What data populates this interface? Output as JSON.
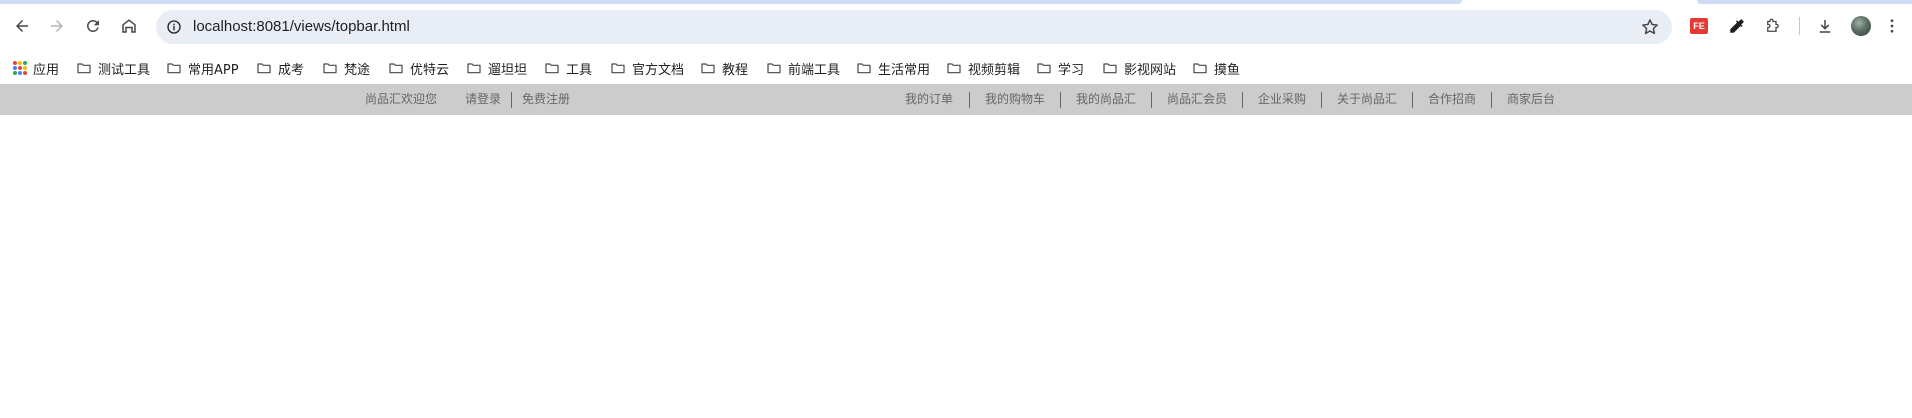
{
  "browser": {
    "url": "localhost:8081/views/topbar.html",
    "extension_badge": "FE",
    "icons": {
      "back": "arrow-left-icon",
      "forward": "arrow-right-icon",
      "reload": "reload-icon",
      "home": "home-icon",
      "site_info": "info-icon",
      "bookmark_star": "star-icon",
      "eyedropper": "eyedropper-icon",
      "extensions": "puzzle-icon",
      "downloads": "download-icon",
      "menu": "kebab-menu-icon"
    }
  },
  "bookmarks": {
    "apps_label": "应用",
    "folders": [
      "测试工具",
      "常用APP",
      "成考",
      "梵途",
      "优特云",
      "遛坦坦",
      "工具",
      "官方文档",
      "教程",
      "前端工具",
      "生活常用",
      "视频剪辑",
      "学习",
      "影视网站",
      "摸鱼"
    ]
  },
  "topbar": {
    "welcome": "尚品汇欢迎您",
    "login": "请登录",
    "register": "免费注册",
    "nav": [
      "我的订单",
      "我的购物车",
      "我的尚品汇",
      "尚品汇会员",
      "企业采购",
      "关于尚品汇",
      "合作招商",
      "商家后台"
    ]
  },
  "colors": {
    "topbar_bg": "#cccccc",
    "topbar_text": "#666666",
    "omnibox_bg": "#e9edf6"
  }
}
